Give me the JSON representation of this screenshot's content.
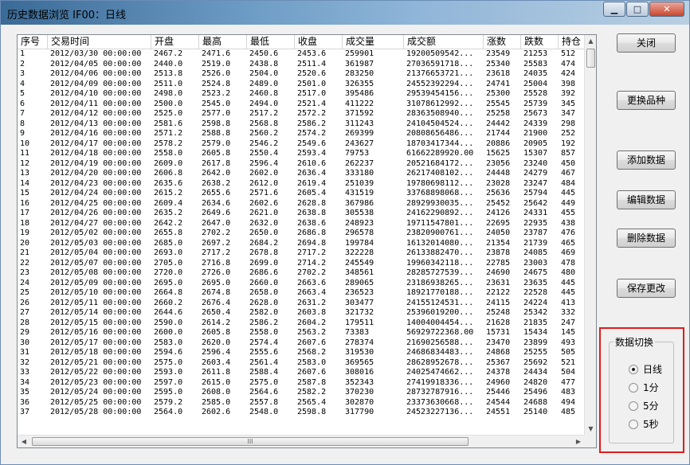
{
  "window": {
    "title": "历史数据浏览 IF00：日线",
    "min": "▁",
    "max": "□",
    "close": "✕"
  },
  "table": {
    "headers": [
      "序号",
      "交易时间",
      "开盘",
      "最高",
      "最低",
      "收盘",
      "成交量",
      "成交额",
      "涨数",
      "跌数",
      "持仓"
    ],
    "rows": [
      [
        "1",
        "2012/03/30 00:00:00",
        "2467.2",
        "2471.6",
        "2450.6",
        "2453.6",
        "259901",
        "19200509542...",
        "23549",
        "21253",
        "512"
      ],
      [
        "2",
        "2012/04/05 00:00:00",
        "2440.0",
        "2519.0",
        "2438.8",
        "2511.4",
        "361987",
        "27036591718...",
        "25340",
        "25583",
        "474"
      ],
      [
        "3",
        "2012/04/06 00:00:00",
        "2513.8",
        "2526.0",
        "2504.0",
        "2520.6",
        "283250",
        "21376653721...",
        "23618",
        "24035",
        "424"
      ],
      [
        "4",
        "2012/04/09 00:00:00",
        "2511.0",
        "2524.8",
        "2489.0",
        "2501.0",
        "326355",
        "24552392294...",
        "24741",
        "25004",
        "398"
      ],
      [
        "5",
        "2012/04/10 00:00:00",
        "2498.0",
        "2523.2",
        "2460.8",
        "2517.0",
        "395486",
        "29539454156...",
        "25300",
        "25528",
        "392"
      ],
      [
        "6",
        "2012/04/11 00:00:00",
        "2500.0",
        "2545.0",
        "2494.0",
        "2521.4",
        "411222",
        "31078612992...",
        "25545",
        "25739",
        "345"
      ],
      [
        "7",
        "2012/04/12 00:00:00",
        "2525.0",
        "2577.0",
        "2517.2",
        "2572.2",
        "371592",
        "28363508940...",
        "25258",
        "25673",
        "347"
      ],
      [
        "8",
        "2012/04/13 00:00:00",
        "2581.6",
        "2598.8",
        "2568.8",
        "2586.2",
        "311243",
        "24104504524...",
        "24442",
        "24339",
        "298"
      ],
      [
        "9",
        "2012/04/16 00:00:00",
        "2571.2",
        "2588.8",
        "2560.2",
        "2574.2",
        "269399",
        "20808656486...",
        "21744",
        "21900",
        "252"
      ],
      [
        "10",
        "2012/04/17 00:00:00",
        "2578.2",
        "2579.0",
        "2546.2",
        "2549.6",
        "243627",
        "18703417344...",
        "20886",
        "20905",
        "192"
      ],
      [
        "11",
        "2012/04/18 00:00:00",
        "2558.0",
        "2605.8",
        "2550.4",
        "2593.4",
        "79753",
        "61662289920.00",
        "15625",
        "15307",
        "857"
      ],
      [
        "12",
        "2012/04/19 00:00:00",
        "2609.0",
        "2617.8",
        "2596.4",
        "2610.6",
        "262237",
        "20521684172...",
        "23056",
        "23240",
        "450"
      ],
      [
        "13",
        "2012/04/20 00:00:00",
        "2606.8",
        "2642.0",
        "2602.0",
        "2636.4",
        "333180",
        "26217408102...",
        "24448",
        "24279",
        "467"
      ],
      [
        "14",
        "2012/04/23 00:00:00",
        "2635.6",
        "2638.2",
        "2612.0",
        "2619.4",
        "251039",
        "19780698112...",
        "23028",
        "23247",
        "484"
      ],
      [
        "15",
        "2012/04/24 00:00:00",
        "2615.2",
        "2655.6",
        "2571.6",
        "2605.4",
        "431519",
        "33768898068...",
        "25636",
        "25794",
        "445"
      ],
      [
        "16",
        "2012/04/25 00:00:00",
        "2609.4",
        "2634.6",
        "2602.6",
        "2628.8",
        "367986",
        "28929930035...",
        "25452",
        "25642",
        "449"
      ],
      [
        "17",
        "2012/04/26 00:00:00",
        "2635.2",
        "2649.6",
        "2621.0",
        "2638.8",
        "305538",
        "24162290892...",
        "24126",
        "24331",
        "455"
      ],
      [
        "18",
        "2012/04/27 00:00:00",
        "2642.2",
        "2647.0",
        "2632.0",
        "2638.6",
        "248923",
        "19711547801...",
        "22695",
        "22935",
        "438"
      ],
      [
        "19",
        "2012/05/02 00:00:00",
        "2655.8",
        "2702.2",
        "2650.0",
        "2686.8",
        "296578",
        "23820900761...",
        "24050",
        "23787",
        "476"
      ],
      [
        "20",
        "2012/05/03 00:00:00",
        "2685.0",
        "2697.2",
        "2684.2",
        "2694.8",
        "199784",
        "16132014080...",
        "21354",
        "21739",
        "465"
      ],
      [
        "21",
        "2012/05/04 00:00:00",
        "2693.0",
        "2717.2",
        "2678.8",
        "2717.2",
        "322228",
        "26133882470...",
        "23878",
        "24085",
        "469"
      ],
      [
        "22",
        "2012/05/07 00:00:00",
        "2705.0",
        "2716.8",
        "2699.0",
        "2714.2",
        "245549",
        "19960342118...",
        "22785",
        "23003",
        "478"
      ],
      [
        "23",
        "2012/05/08 00:00:00",
        "2720.0",
        "2726.0",
        "2686.6",
        "2702.2",
        "348561",
        "28285727539...",
        "24690",
        "24675",
        "480"
      ],
      [
        "24",
        "2012/05/09 00:00:00",
        "2695.0",
        "2695.0",
        "2660.0",
        "2663.6",
        "289065",
        "23186938265...",
        "23631",
        "23635",
        "445"
      ],
      [
        "25",
        "2012/05/10 00:00:00",
        "2664.8",
        "2674.8",
        "2658.0",
        "2663.4",
        "236523",
        "18921770188...",
        "22122",
        "22528",
        "445"
      ],
      [
        "26",
        "2012/05/11 00:00:00",
        "2660.2",
        "2676.4",
        "2628.0",
        "2631.2",
        "303477",
        "24155124531...",
        "24115",
        "24224",
        "413"
      ],
      [
        "27",
        "2012/05/14 00:00:00",
        "2644.6",
        "2650.4",
        "2582.0",
        "2603.8",
        "321732",
        "25396019200...",
        "25248",
        "25342",
        "332"
      ],
      [
        "28",
        "2012/05/15 00:00:00",
        "2590.0",
        "2614.2",
        "2586.2",
        "2604.2",
        "179511",
        "14004004454...",
        "21628",
        "21835",
        "247"
      ],
      [
        "29",
        "2012/05/16 00:00:00",
        "2600.0",
        "2605.8",
        "2558.0",
        "2563.2",
        "73383",
        "56929722368.00",
        "15731",
        "15434",
        "145"
      ],
      [
        "30",
        "2012/05/17 00:00:00",
        "2583.0",
        "2620.0",
        "2574.4",
        "2607.6",
        "278374",
        "21690256588...",
        "23470",
        "23899",
        "493"
      ],
      [
        "31",
        "2012/05/18 00:00:00",
        "2594.6",
        "2596.4",
        "2555.6",
        "2568.2",
        "319530",
        "24686834483...",
        "24868",
        "25255",
        "505"
      ],
      [
        "32",
        "2012/05/21 00:00:00",
        "2575.0",
        "2603.4",
        "2561.4",
        "2583.0",
        "369565",
        "28628952678...",
        "25367",
        "25692",
        "521"
      ],
      [
        "33",
        "2012/05/22 00:00:00",
        "2593.0",
        "2611.8",
        "2588.4",
        "2607.6",
        "308016",
        "24025474662...",
        "24378",
        "24434",
        "504"
      ],
      [
        "34",
        "2012/05/23 00:00:00",
        "2597.0",
        "2615.0",
        "2575.0",
        "2587.8",
        "352343",
        "27419918336...",
        "24960",
        "24820",
        "477"
      ],
      [
        "35",
        "2012/05/24 00:00:00",
        "2595.0",
        "2608.0",
        "2564.6",
        "2582.2",
        "370230",
        "28732787916...",
        "25446",
        "25496",
        "483"
      ],
      [
        "36",
        "2012/05/25 00:00:00",
        "2579.2",
        "2585.0",
        "2557.8",
        "2565.4",
        "302870",
        "23373630668...",
        "24544",
        "24688",
        "494"
      ],
      [
        "37",
        "2012/05/28 00:00:00",
        "2564.0",
        "2602.6",
        "2548.0",
        "2598.8",
        "317790",
        "24523227136...",
        "24551",
        "25140",
        "485"
      ]
    ]
  },
  "scroll": {
    "grip": "III",
    "up": "▲",
    "down": "▼",
    "left": "◀",
    "right": "▶"
  },
  "buttons": {
    "close": "关闭",
    "change_symbol": "更换品种",
    "add": "添加数据",
    "edit": "编辑数据",
    "delete": "删除数据",
    "save": "保存更改"
  },
  "switch": {
    "legend": "数据切换",
    "options": [
      "日线",
      "1分",
      "5分",
      "5秒"
    ],
    "selected": "日线"
  }
}
